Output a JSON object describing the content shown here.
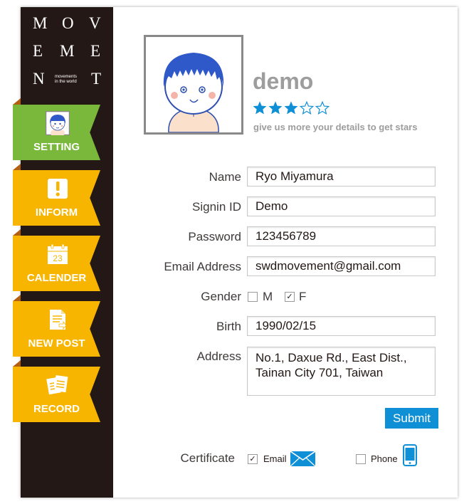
{
  "brand": {
    "letters_row1": [
      "M",
      "O",
      "V"
    ],
    "letters_row2": [
      "E",
      "M",
      "E"
    ],
    "letters_row3_left": "N",
    "letters_row3_right": "T",
    "tagline_line1": "movements",
    "tagline_line2": "in the world"
  },
  "nav": [
    {
      "label": "SETTING",
      "icon": "avatar-icon",
      "color": "#7ab83b"
    },
    {
      "label": "INFORM",
      "icon": "exclamation-icon",
      "color": "#f7b500"
    },
    {
      "label": "CALENDER",
      "icon": "calendar-icon",
      "color": "#f7b500",
      "day": "23"
    },
    {
      "label": "NEW POST",
      "icon": "document-icon",
      "color": "#f7b500"
    },
    {
      "label": "RECORD",
      "icon": "records-icon",
      "color": "#f7b500"
    }
  ],
  "profile": {
    "username": "demo",
    "rating": 3,
    "rating_max": 5,
    "hint": "give us more your details to get stars"
  },
  "form": {
    "name_label": "Name",
    "name_value": "Ryo Miyamura",
    "signin_label": "Signin ID",
    "signin_value": "Demo",
    "password_label": "Password",
    "password_value": "123456789",
    "email_label": "Email Address",
    "email_value": "swdmovement@gmail.com",
    "gender_label": "Gender",
    "gender_m": "M",
    "gender_f": "F",
    "gender_selected": "F",
    "check_mark": "✓",
    "birth_label": "Birth",
    "birth_value": "1990/02/15",
    "address_label": "Address",
    "address_value": "No.1, Daxue Rd., East Dist.,\nTainan City 701, Taiwan",
    "submit_label": "Submit"
  },
  "certificate": {
    "label": "Certificate",
    "email_label": "Email",
    "email_checked": true,
    "phone_label": "Phone",
    "phone_checked": false
  },
  "colors": {
    "sidebar": "#231815",
    "setting_green": "#7ab83b",
    "menu_yellow": "#f7b500",
    "accent_blue": "#0e8fd6",
    "muted_text": "#9d9d9d"
  }
}
